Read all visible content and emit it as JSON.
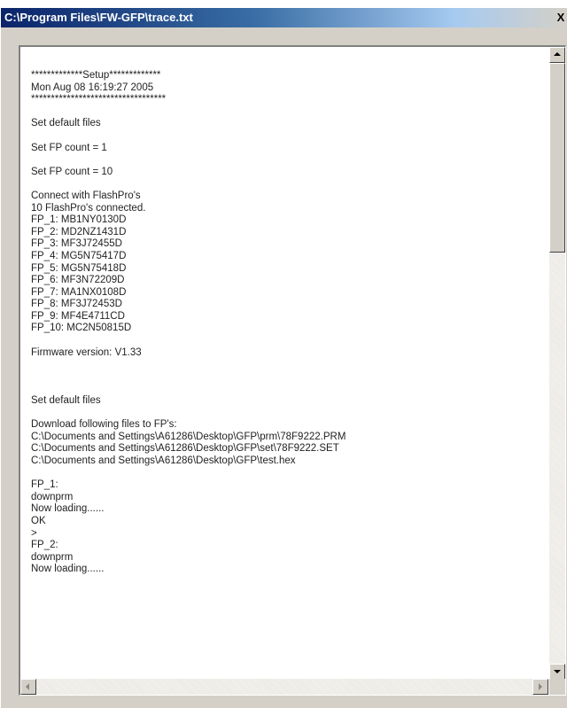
{
  "window": {
    "title": "C:\\Program Files\\FW-GFP\\trace.txt",
    "close_label": "X"
  },
  "trace": {
    "blocks": [
      [
        "*************Setup*************",
        "Mon Aug 08 16:19:27 2005",
        "**********************************"
      ],
      [
        "Set default files"
      ],
      [
        "Set FP count = 1"
      ],
      [
        "Set FP count = 10"
      ],
      [
        "Connect with FlashPro's",
        "10 FlashPro's connected.",
        "FP_1: MB1NY0130D",
        "FP_2: MD2NZ1431D",
        "FP_3: MF3J72455D",
        "FP_4: MG5N75417D",
        "FP_5: MG5N75418D",
        "FP_6: MF3N72209D",
        "FP_7: MA1NX0108D",
        "FP_8: MF3J72453D",
        "FP_9: MF4E4711CD",
        "FP_10: MC2N50815D"
      ],
      [
        "Firmware version: V1.33"
      ],
      [
        ""
      ],
      [
        "Set default files"
      ],
      [
        "Download following files to FP's:",
        "C:\\Documents and Settings\\A61286\\Desktop\\GFP\\prm\\78F9222.PRM",
        "C:\\Documents and Settings\\A61286\\Desktop\\GFP\\set\\78F9222.SET",
        "C:\\Documents and Settings\\A61286\\Desktop\\GFP\\test.hex"
      ],
      [
        "FP_1:",
        "downprm",
        "Now loading......",
        "OK",
        ">",
        "FP_2:",
        "downprm",
        "Now loading......"
      ]
    ]
  }
}
